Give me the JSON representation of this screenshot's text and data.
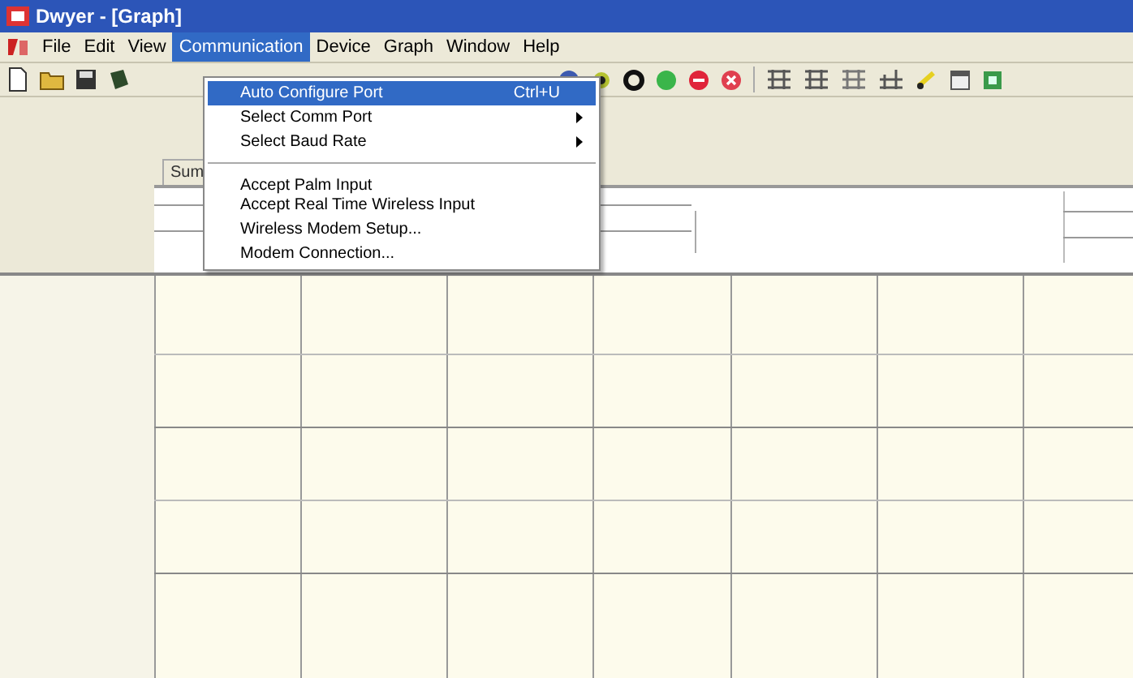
{
  "window": {
    "title": "Dwyer - [Graph]"
  },
  "menu_bar": [
    {
      "label": "File",
      "selected": false
    },
    {
      "label": "Edit",
      "selected": false
    },
    {
      "label": "View",
      "selected": false
    },
    {
      "label": "Communication",
      "selected": true
    },
    {
      "label": "Device",
      "selected": false
    },
    {
      "label": "Graph",
      "selected": false
    },
    {
      "label": "Window",
      "selected": false
    },
    {
      "label": "Help",
      "selected": false
    }
  ],
  "dropdown_menu": [
    {
      "label": "Auto Configure Port",
      "shortcut": "Ctrl+U",
      "selected": true,
      "submenu": false,
      "separator_before": false
    },
    {
      "label": "Select Comm Port",
      "selected": false,
      "submenu": true,
      "separator_before": false
    },
    {
      "label": "Select Baud Rate",
      "selected": false,
      "submenu": true,
      "separator_before": false
    },
    {
      "label": "Accept Palm Input",
      "selected": false,
      "submenu": false,
      "separator_before": true
    },
    {
      "label": "Accept Real Time Wireless Input",
      "selected": false,
      "submenu": false,
      "separator_before": false
    },
    {
      "label": "Wireless Modem Setup...",
      "selected": false,
      "submenu": false,
      "separator_before": false
    },
    {
      "label": "Modem Connection...",
      "selected": false,
      "submenu": false,
      "separator_before": false
    }
  ],
  "document_tab": {
    "label": "Sum"
  }
}
